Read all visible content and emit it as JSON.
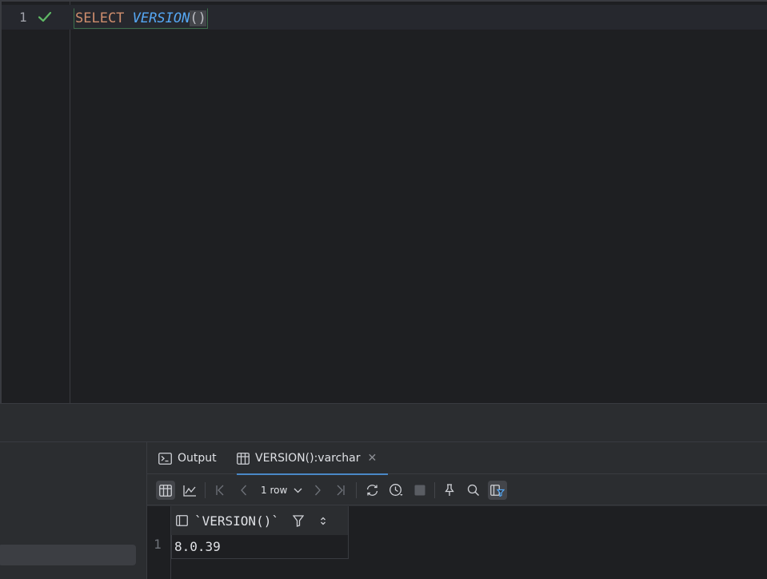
{
  "editor": {
    "line_number": "1",
    "code": {
      "keyword": "SELECT",
      "function": "VERSION",
      "parens": "()"
    }
  },
  "results": {
    "tabs": [
      {
        "label": "Output",
        "icon": "console-icon"
      },
      {
        "label": "VERSION():varchar",
        "icon": "table-icon",
        "active": true
      }
    ],
    "toolbar": {
      "rows_label": "1 row"
    },
    "grid": {
      "columns": [
        "`VERSION()`"
      ],
      "rows": [
        {
          "num": "1",
          "cells": [
            "8.0.39"
          ]
        }
      ]
    }
  },
  "colors": {
    "editor_bg": "#1e1f22",
    "panel_bg": "#2b2d30",
    "keyword": "#cf8e6d",
    "function": "#56a8f5",
    "success_check": "#5fb865",
    "active_tab_underline": "#4a88c7"
  }
}
